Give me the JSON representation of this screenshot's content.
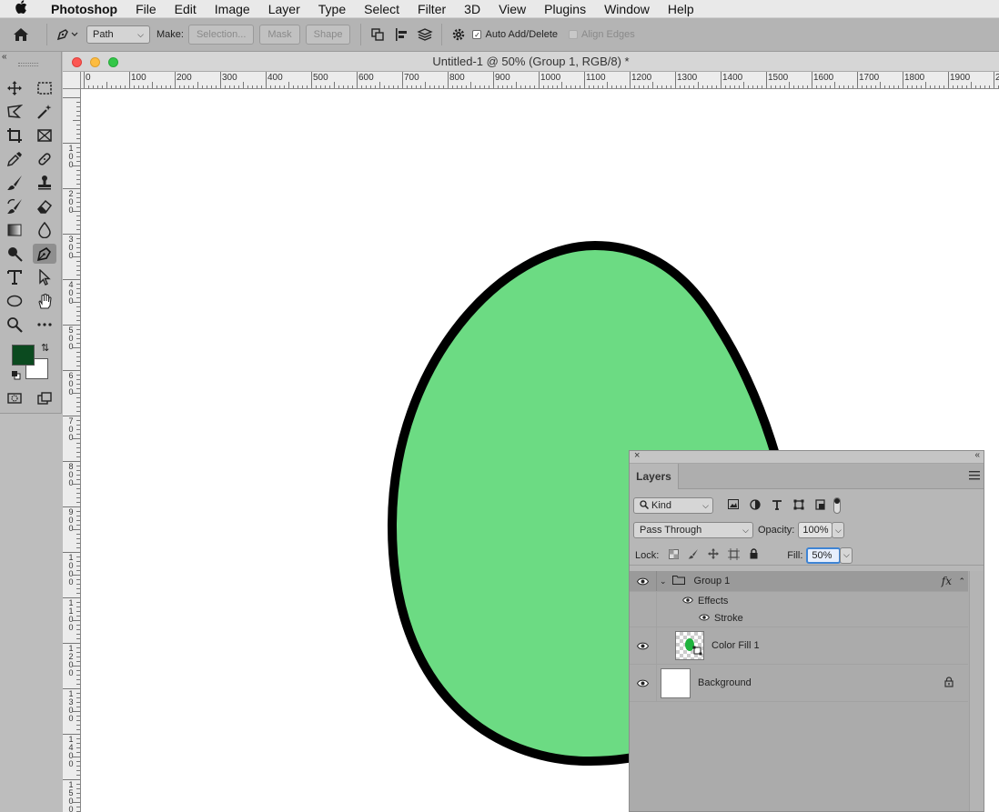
{
  "menubar": {
    "app_name": "Photoshop",
    "items": [
      "File",
      "Edit",
      "Image",
      "Layer",
      "Type",
      "Select",
      "Filter",
      "3D",
      "View",
      "Plugins",
      "Window",
      "Help"
    ]
  },
  "options": {
    "mode_value": "Path",
    "make_label": "Make:",
    "selection_label": "Selection...",
    "mask_label": "Mask",
    "shape_label": "Shape",
    "auto_add_delete_label": "Auto Add/Delete",
    "auto_add_delete_checked": true,
    "align_edges_label": "Align Edges",
    "align_edges_checked": false
  },
  "tools": {
    "foreground_color": "#0b4a1f",
    "background_color": "#ffffff",
    "active_tool": "pen-tool"
  },
  "document": {
    "title": "Untitled-1 @ 50% (Group 1, RGB/8) *",
    "ruler_h_labels": [
      "0",
      "100",
      "200",
      "300",
      "400",
      "500",
      "600",
      "700",
      "800",
      "900",
      "1000",
      "1100",
      "1200",
      "1300",
      "1400",
      "1500",
      "1600",
      "1700",
      "1800",
      "1900",
      "20"
    ],
    "ruler_v_labels": [
      "1\n0\n0",
      "2\n0\n0",
      "3\n0\n0",
      "4\n0\n0",
      "5\n0\n0",
      "6\n0\n0",
      "7\n0\n0",
      "8\n0\n0",
      "9\n0\n0",
      "1\n0\n0\n0",
      "1\n1\n0\n0",
      "1\n2\n0\n0",
      "1\n3\n0\n0",
      "1\n4\n0\n0",
      "1\n5\n0\n0"
    ],
    "shape_fill": "#6cdb83",
    "shape_stroke": "#000000"
  },
  "layers_panel": {
    "tab_label": "Layers",
    "filter_kind": "Kind",
    "blend_mode": "Pass Through",
    "opacity_label": "Opacity:",
    "opacity_value": "100%",
    "lock_label": "Lock:",
    "fill_label": "Fill:",
    "fill_value": "50%",
    "layers": [
      {
        "name": "Group 1",
        "fx": "fx",
        "selected": true
      },
      {
        "name": "Effects"
      },
      {
        "name": "Stroke"
      },
      {
        "name": "Color Fill 1"
      },
      {
        "name": "Background",
        "locked": true
      }
    ]
  }
}
